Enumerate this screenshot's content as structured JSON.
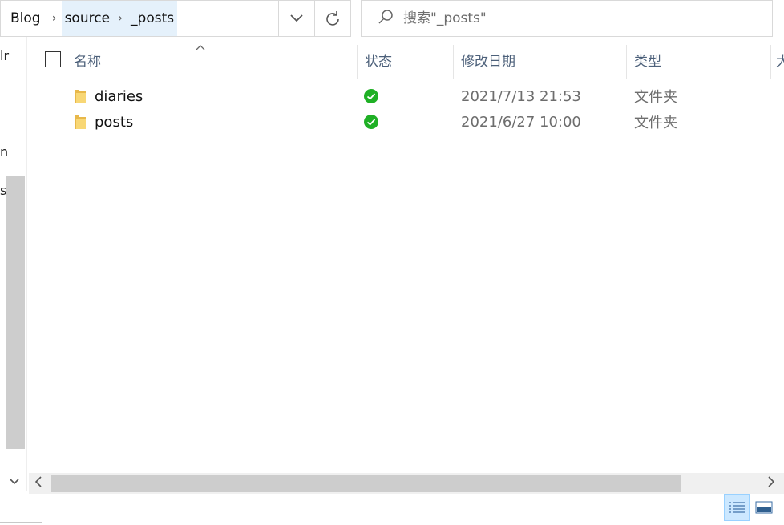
{
  "breadcrumb": {
    "items": [
      {
        "label": "Blog"
      },
      {
        "label": "source"
      },
      {
        "label": "_posts"
      }
    ],
    "separator": "›"
  },
  "address_buttons": {
    "dropdown_icon": "chevron-down-icon",
    "refresh_icon": "refresh-icon"
  },
  "search": {
    "placeholder": "搜索\"_posts\"",
    "icon": "search-icon"
  },
  "left_pane": {
    "fragments": [
      "lr",
      "n",
      "s"
    ]
  },
  "columns": {
    "name": "名称",
    "status": "状态",
    "modified": "修改日期",
    "type": "类型",
    "size_partial": "大"
  },
  "files": [
    {
      "name": "diaries",
      "status": "synced",
      "modified": "2021/7/13 21:53",
      "type": "文件夹"
    },
    {
      "name": "posts",
      "status": "synced",
      "modified": "2021/6/27 10:00",
      "type": "文件夹"
    }
  ],
  "colors": {
    "accent_highlight": "#e5f1fb",
    "header_text": "#4c607a",
    "status_green": "#1fb025",
    "folder_yellow": "#f4c95d",
    "scroll_thumb": "#cdcdcd"
  },
  "view_buttons": [
    {
      "name": "details-view-icon",
      "active": true
    },
    {
      "name": "large-icons-view-icon",
      "active": false
    }
  ]
}
